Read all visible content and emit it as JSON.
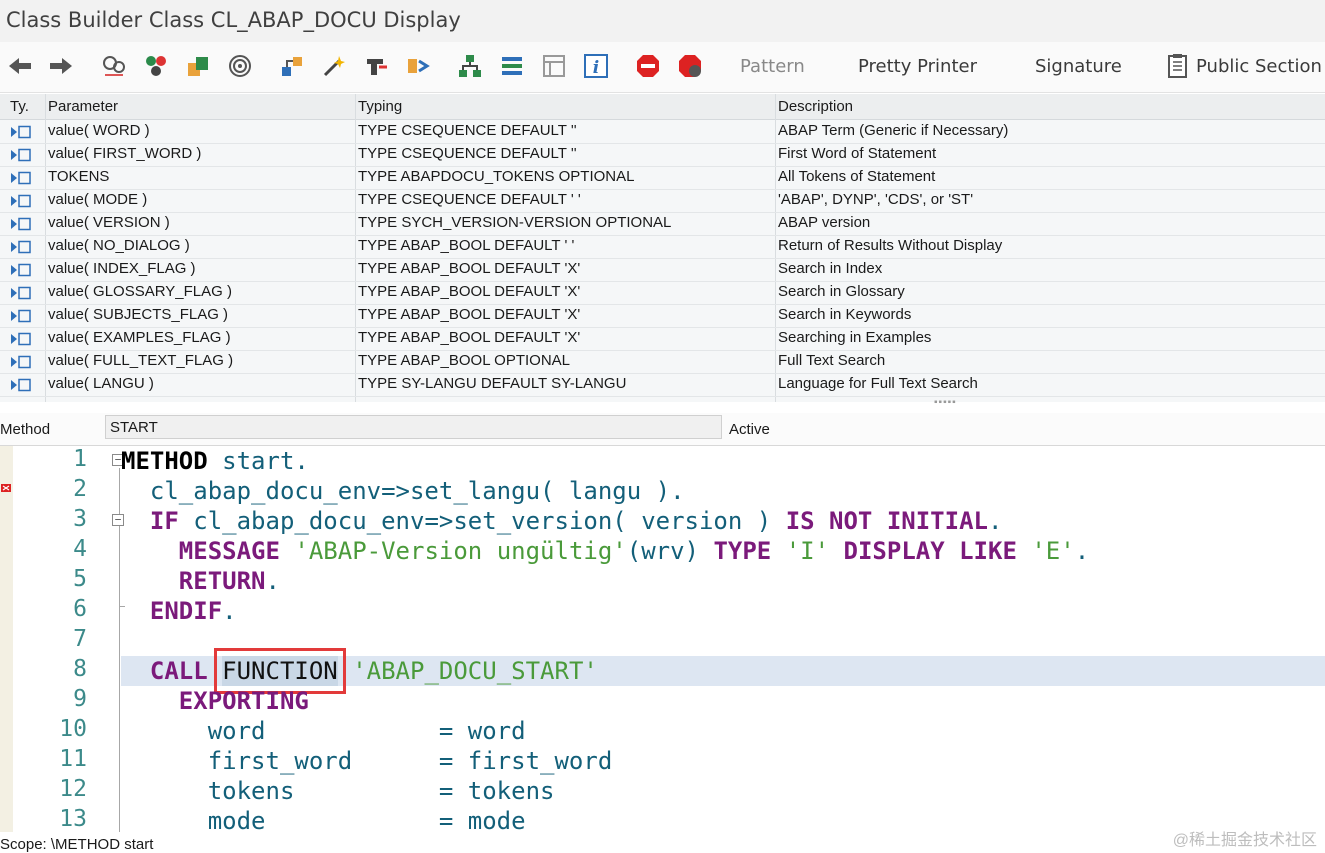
{
  "window": {
    "title": "Class Builder Class CL_ABAP_DOCU Display"
  },
  "toolbar": {
    "icons": [
      "back-arrow-icon",
      "forward-arrow-icon",
      "other-object-icon",
      "display-change-icon",
      "active-inactive-icon",
      "object-list-icon",
      "where-used-icon",
      "check-icon",
      "activate-icon",
      "test-icon",
      "hierarchy-icon",
      "documentation-icon",
      "display-object-list-icon",
      "info-icon",
      "breakpoint-icon",
      "session-breakpoint-icon"
    ],
    "pattern_label": "Pattern",
    "pretty_printer_label": "Pretty Printer",
    "signature_label": "Signature",
    "public_section_label": "Public Section"
  },
  "params": {
    "headers": {
      "type": "Ty.",
      "parameter": "Parameter",
      "typing": "Typing",
      "description": "Description"
    },
    "rows": [
      {
        "parameter": "value( WORD )",
        "typing": "TYPE CSEQUENCE  DEFAULT ''",
        "description": "ABAP Term (Generic if Necessary)"
      },
      {
        "parameter": "value( FIRST_WORD )",
        "typing": "TYPE CSEQUENCE  DEFAULT ''",
        "description": "First Word of Statement"
      },
      {
        "parameter": "TOKENS",
        "typing": "TYPE ABAPDOCU_TOKENS OPTIONAL",
        "description": "All Tokens of Statement"
      },
      {
        "parameter": "value( MODE )",
        "typing": "TYPE CSEQUENCE  DEFAULT ' '",
        "description": "'ABAP', DYNP', 'CDS', or 'ST'"
      },
      {
        "parameter": "value( VERSION )",
        "typing": "TYPE SYCH_VERSION-VERSION OPTIONAL",
        "description": "ABAP version"
      },
      {
        "parameter": "value( NO_DIALOG )",
        "typing": "TYPE ABAP_BOOL  DEFAULT ' '",
        "description": "Return of Results Without Display"
      },
      {
        "parameter": "value( INDEX_FLAG )",
        "typing": "TYPE ABAP_BOOL  DEFAULT 'X'",
        "description": "Search in Index"
      },
      {
        "parameter": "value( GLOSSARY_FLAG )",
        "typing": "TYPE ABAP_BOOL  DEFAULT 'X'",
        "description": "Search in Glossary"
      },
      {
        "parameter": "value( SUBJECTS_FLAG )",
        "typing": "TYPE ABAP_BOOL  DEFAULT 'X'",
        "description": "Search in Keywords"
      },
      {
        "parameter": "value( EXAMPLES_FLAG )",
        "typing": "TYPE ABAP_BOOL  DEFAULT 'X'",
        "description": "Searching in Examples"
      },
      {
        "parameter": "value( FULL_TEXT_FLAG )",
        "typing": "TYPE ABAP_BOOL OPTIONAL",
        "description": "Full Text Search"
      },
      {
        "parameter": "value( LANGU )",
        "typing": "TYPE SY-LANGU  DEFAULT SY-LANGU",
        "description": "Language for Full Text Search"
      }
    ]
  },
  "method_bar": {
    "label": "Method",
    "value": "START",
    "status": "Active"
  },
  "editor": {
    "line_numbers": [
      "1",
      "2",
      "3",
      "4",
      "5",
      "6",
      "7",
      "8",
      "9",
      "10",
      "11",
      "12",
      "13"
    ],
    "lines": [
      [
        {
          "t": "METHOD",
          "c": "kw-b"
        },
        {
          "t": " start.",
          "c": "id"
        }
      ],
      [
        {
          "t": "  cl_abap_docu_env=>set_langu( langu ).",
          "c": "id"
        }
      ],
      [
        {
          "t": "  ",
          "c": "id"
        },
        {
          "t": "IF",
          "c": "kw"
        },
        {
          "t": " cl_abap_docu_env=>set_version( version ) ",
          "c": "id"
        },
        {
          "t": "IS NOT INITIAL",
          "c": "kw"
        },
        {
          "t": ".",
          "c": "id"
        }
      ],
      [
        {
          "t": "    ",
          "c": "id"
        },
        {
          "t": "MESSAGE",
          "c": "kw"
        },
        {
          "t": " ",
          "c": "id"
        },
        {
          "t": "'ABAP-Version ungültig'",
          "c": "str"
        },
        {
          "t": "(wrv) ",
          "c": "id"
        },
        {
          "t": "TYPE",
          "c": "kw"
        },
        {
          "t": " ",
          "c": "id"
        },
        {
          "t": "'I'",
          "c": "str"
        },
        {
          "t": " ",
          "c": "id"
        },
        {
          "t": "DISPLAY LIKE",
          "c": "kw"
        },
        {
          "t": " ",
          "c": "id"
        },
        {
          "t": "'E'",
          "c": "str"
        },
        {
          "t": ".",
          "c": "id"
        }
      ],
      [
        {
          "t": "    ",
          "c": "id"
        },
        {
          "t": "RETURN",
          "c": "kw"
        },
        {
          "t": ".",
          "c": "id"
        }
      ],
      [
        {
          "t": "  ",
          "c": "id"
        },
        {
          "t": "ENDIF",
          "c": "kw"
        },
        {
          "t": ".",
          "c": "id"
        }
      ],
      [],
      [
        {
          "t": "  ",
          "c": "id"
        },
        {
          "t": "CALL",
          "c": "kw"
        },
        {
          "t": " ",
          "c": "id"
        },
        {
          "t": "FUNCTION",
          "c": "funcbox"
        },
        {
          "t": " ",
          "c": "id"
        },
        {
          "t": "'ABAP_DOCU_START'",
          "c": "str"
        }
      ],
      [
        {
          "t": "    ",
          "c": "id"
        },
        {
          "t": "EXPORTING",
          "c": "kw"
        }
      ],
      [
        {
          "t": "      word            = word",
          "c": "id"
        }
      ],
      [
        {
          "t": "      first_word      = first_word",
          "c": "id"
        }
      ],
      [
        {
          "t": "      tokens          = tokens",
          "c": "id"
        }
      ],
      [
        {
          "t": "      mode            = mode",
          "c": "id"
        }
      ]
    ],
    "highlighted_line": 8
  },
  "status_bar": {
    "text": "Scope: \\METHOD start"
  },
  "watermark": "@稀土掘金技术社区"
}
